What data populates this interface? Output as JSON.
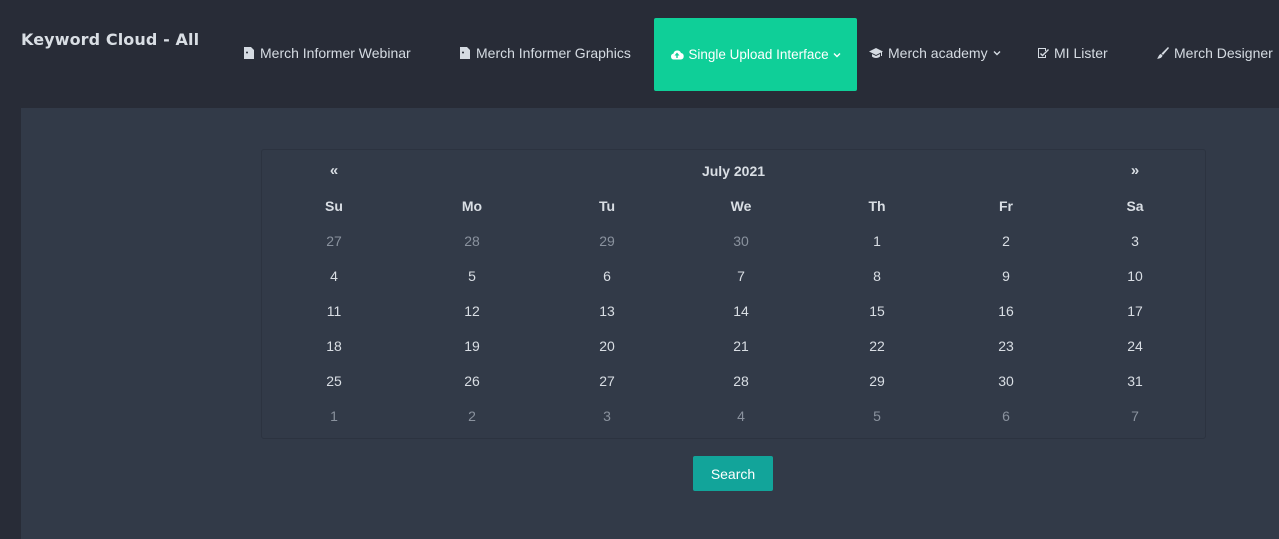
{
  "brand": "Keyword Cloud - All",
  "nav": {
    "webinar": {
      "label": "Merch Informer Webinar",
      "icon": "file-image-icon"
    },
    "graphics": {
      "label": "Merch Informer Graphics",
      "icon": "file-image-icon"
    },
    "upload": {
      "label": "Single Upload Interface",
      "icon": "cloud-upload-icon",
      "active": true
    },
    "academy": {
      "label": "Merch academy",
      "icon": "graduation-cap-icon"
    },
    "lister": {
      "label": "MI Lister",
      "icon": "checklist-icon"
    },
    "designer": {
      "label": "Merch Designer",
      "icon": "brush-icon"
    }
  },
  "calendar": {
    "title": "July 2021",
    "prev": "«",
    "next": "»",
    "days_of_week": [
      "Su",
      "Mo",
      "Tu",
      "We",
      "Th",
      "Fr",
      "Sa"
    ],
    "weeks": [
      [
        {
          "d": "27",
          "m": true
        },
        {
          "d": "28",
          "m": true
        },
        {
          "d": "29",
          "m": true
        },
        {
          "d": "30",
          "m": true
        },
        {
          "d": "1"
        },
        {
          "d": "2"
        },
        {
          "d": "3"
        }
      ],
      [
        {
          "d": "4"
        },
        {
          "d": "5"
        },
        {
          "d": "6"
        },
        {
          "d": "7"
        },
        {
          "d": "8"
        },
        {
          "d": "9"
        },
        {
          "d": "10"
        }
      ],
      [
        {
          "d": "11"
        },
        {
          "d": "12"
        },
        {
          "d": "13"
        },
        {
          "d": "14"
        },
        {
          "d": "15"
        },
        {
          "d": "16"
        },
        {
          "d": "17"
        }
      ],
      [
        {
          "d": "18"
        },
        {
          "d": "19"
        },
        {
          "d": "20"
        },
        {
          "d": "21"
        },
        {
          "d": "22"
        },
        {
          "d": "23"
        },
        {
          "d": "24"
        }
      ],
      [
        {
          "d": "25"
        },
        {
          "d": "26"
        },
        {
          "d": "27"
        },
        {
          "d": "28"
        },
        {
          "d": "29"
        },
        {
          "d": "30"
        },
        {
          "d": "31"
        }
      ],
      [
        {
          "d": "1",
          "m": true
        },
        {
          "d": "2",
          "m": true
        },
        {
          "d": "3",
          "m": true
        },
        {
          "d": "4",
          "m": true
        },
        {
          "d": "5",
          "m": true
        },
        {
          "d": "6",
          "m": true
        },
        {
          "d": "7",
          "m": true
        }
      ]
    ]
  },
  "search_label": "Search",
  "colors": {
    "accent": "#0fcf98",
    "button": "#12a49a",
    "background": "#282c37",
    "panel": "#323a48"
  }
}
